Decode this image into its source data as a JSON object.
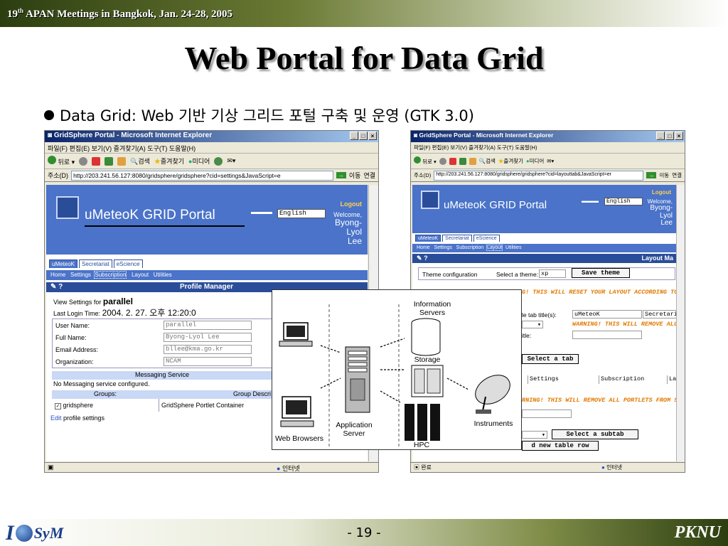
{
  "header": {
    "meeting_sup": "th",
    "meeting_num": "19",
    "meeting_rest": "APAN Meetings in Bangkok, Jan. 24-28, 2005"
  },
  "slide": {
    "title": "Web Portal  for Data Grid",
    "bullet": "Data Grid: Web 기반 기상 그리드 포털 구축 및 운영 (GTK 3.0)",
    "page_number": "- 19 -",
    "footer_right": "PKNU",
    "footer_logo": "I SyM"
  },
  "browser_common": {
    "menu": "파일(F)   편집(E)   보기(V)   즐겨찾기(A)   도구(T)   도움말(H)",
    "back": "뒤로",
    "search": "검색",
    "favorites": "즐겨찾기",
    "media": "미디어",
    "address_label": "주소(D)",
    "go": "이동",
    "links": "연결",
    "internet": "인터넷",
    "portal_title": "uMeteoK GRID Portal",
    "language": "English",
    "logout": "Logout",
    "welcome": "Welcome,",
    "user_first": "Byong-",
    "user_mid": "Lyol",
    "user_last": "Lee",
    "tabs": [
      "uMeteoK",
      "Secretariat",
      "eScience"
    ]
  },
  "window1": {
    "title": "GridSphere Portal - Microsoft Internet Explorer",
    "url": "http://203.241.56.127:8080/gridsphere/gridsphere?cid=settings&JavaScript=e",
    "subnav": [
      "Home",
      "Settings",
      "Subscription",
      "Layout",
      "Utilities"
    ],
    "portlet_title": "Profile Manager",
    "view_settings_label": "View Settings for",
    "view_settings_user": "parallel",
    "last_login_label": "Last Login Time:",
    "last_login_value": "2004. 2. 27. 오후 12:20:0",
    "fields": [
      {
        "label": "User Name:",
        "value": "parallel"
      },
      {
        "label": "Full Name:",
        "value": "Byong-Lyol Lee"
      },
      {
        "label": "Email Address:",
        "value": "bllee@kma.go.kr"
      },
      {
        "label": "Organization:",
        "value": "NCAM"
      }
    ],
    "messaging_header": "Messaging Service",
    "messaging_text": "No Messaging service configured.",
    "groups_header": "Groups:",
    "group_desc_header": "Group Descri",
    "group_name": "gridsphere",
    "group_desc": "GridSphere Portlet Container",
    "edit_link": "Edit",
    "edit_text": "profile settings"
  },
  "window2": {
    "title": "GridSphere Portal - Microsoft Internet Explorer",
    "url": "http://203.241.56.127:8080/gridsphere/gridsphere?cid=layouttab&JavaScript=er",
    "subnav": [
      "Home",
      "Settings",
      "Subscription",
      "Layout",
      "Utilities"
    ],
    "portlet_title": "Layout Ma",
    "theme_label": "Theme configuration",
    "theme_select_label": "Select a theme:",
    "theme_value": "xp",
    "save_theme": "Save theme",
    "warn1": "G! THIS WILL RESET YOUR LAYOUT ACCORDING TO R",
    "tab_title_label": "le tab title(s):",
    "tab_values": [
      "uMeteoK",
      "Secretaria"
    ],
    "warn2": "WARNING! THIS WILL REMOVE ALL",
    "title_label": "itle:",
    "select_tab": "Select a tab",
    "subtab_values": [
      "Settings",
      "Subscription",
      "La"
    ],
    "warn3": "RNING! THIS WILL REMOVE ALL PORTLETS FROM SEL",
    "select_subtab": "Select a subtab",
    "new_row": "d new table row",
    "status": "완료",
    "internet": "인터넷"
  },
  "diagram": {
    "labels": {
      "info": "Information\nServers",
      "storage": "Storage",
      "app": "Application\nServer",
      "web": "Web Browsers",
      "hpc": "HPC",
      "instruments": "Instruments"
    }
  },
  "colors": {
    "portal_blue": "#4a73c9",
    "portal_dark": "#2a4d99",
    "warning_orange": "#e07b00",
    "header_green": "#2c3e10"
  }
}
